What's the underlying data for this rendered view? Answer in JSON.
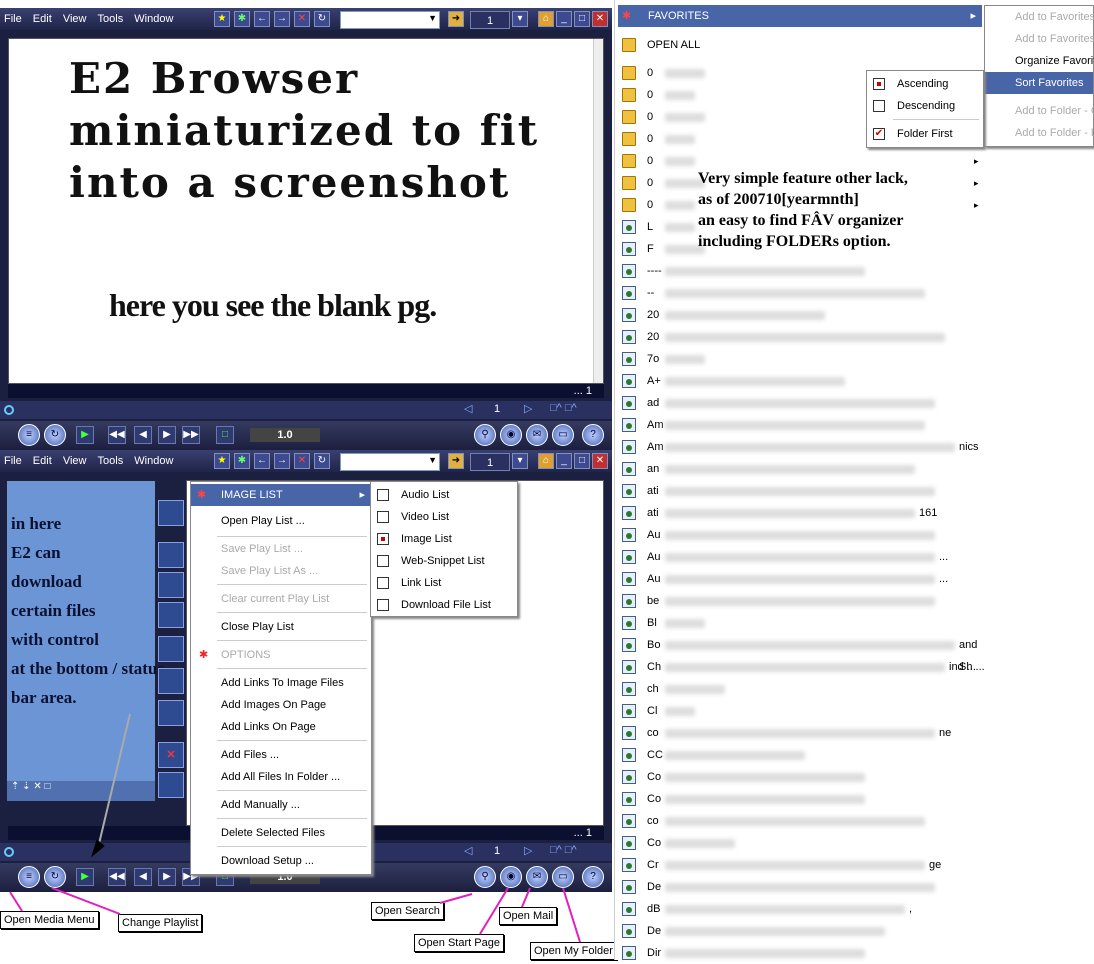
{
  "menu_labels": [
    "File",
    "Edit",
    "View",
    "Tools",
    "Window"
  ],
  "top_window": {
    "page_number": "1",
    "headline": "E2 Browser miniaturized to fit into a screenshot",
    "subline": "here you see the blank pg.",
    "status_text": "... 1",
    "nav_page": "1",
    "zoom": "1.0"
  },
  "bottom_window": {
    "page_number": "1",
    "sidebar_note": [
      "in here",
      "E2 can",
      "download",
      "certain files",
      "with control",
      "at the bottom / status",
      "bar area."
    ],
    "status_text": "... 1",
    "nav_page": "1",
    "zoom": "1.0"
  },
  "media_menu": {
    "header": "IMAGE LIST",
    "items": [
      "Open Play List ...",
      "Save Play List ...",
      "Save Play List As ...",
      "Clear current Play List",
      "Close Play List",
      "OPTIONS",
      "Add Links To Image Files",
      "Add Images On Page",
      "Add Links On Page",
      "Add Files ...",
      "Add All Files In Folder ...",
      "Add Manually ...",
      "Delete Selected Files",
      "Download Setup ..."
    ]
  },
  "list_submenu": {
    "items": [
      {
        "label": "Audio List",
        "checked": false
      },
      {
        "label": "Video List",
        "checked": false
      },
      {
        "label": "Image List",
        "checked": true
      },
      {
        "label": "Web-Snippet List",
        "checked": false
      },
      {
        "label": "Link List",
        "checked": false
      },
      {
        "label": "Download File List",
        "checked": false
      }
    ]
  },
  "callouts": {
    "open_media_menu": "Open Media Menu",
    "change_playlist": "Change Playlist",
    "open_search": "Open Search",
    "open_start_page": "Open Start Page",
    "open_mail": "Open Mail",
    "open_my_folder": "Open My Folder"
  },
  "favorites": {
    "header": "FAVORITES",
    "open_all": "OPEN ALL",
    "submenu": [
      "Add to Favorites",
      "Add to Favorites",
      "Organize Favorit",
      "Sort Favorites",
      "Add to Folder - C",
      "Add to Folder - L"
    ],
    "sort_options": [
      {
        "label": "Ascending",
        "checked": true
      },
      {
        "label": "Descending",
        "checked": false
      },
      {
        "label": "Folder First",
        "checked": true
      }
    ],
    "annotation": [
      "Very simple feature other lack,",
      "as of 200710[yearmnth]",
      "an easy to find FÂV organizer",
      "including FOLDERs option."
    ],
    "rows": [
      "0",
      "0",
      "0",
      "0",
      "0",
      "0",
      "0",
      "L",
      "F",
      "----",
      "--",
      "20",
      "20",
      "7o",
      "A+",
      "ad",
      "Am",
      "Am",
      "an",
      "ati",
      "ati",
      "Au",
      "Au",
      "Au",
      "be",
      "Bl",
      "Bo",
      "Ch",
      "ch",
      "Cl",
      "co",
      "CC",
      "Co",
      "Co",
      "co",
      "Co",
      "Cr",
      "De",
      "dB",
      "De",
      "Dir"
    ],
    "row_suffix": {
      "17": "nics",
      "20": "161",
      "22": "...",
      "23": "...",
      "26": "and Sh ...",
      "27": "ind ...",
      "30": "ne",
      "36": "ge",
      "38": ","
    }
  },
  "colors": {
    "accent": "#4865a8",
    "window_bg": "#1b2040",
    "sidebar_bg": "#6c95d6",
    "callout_line": "#e020c0"
  }
}
